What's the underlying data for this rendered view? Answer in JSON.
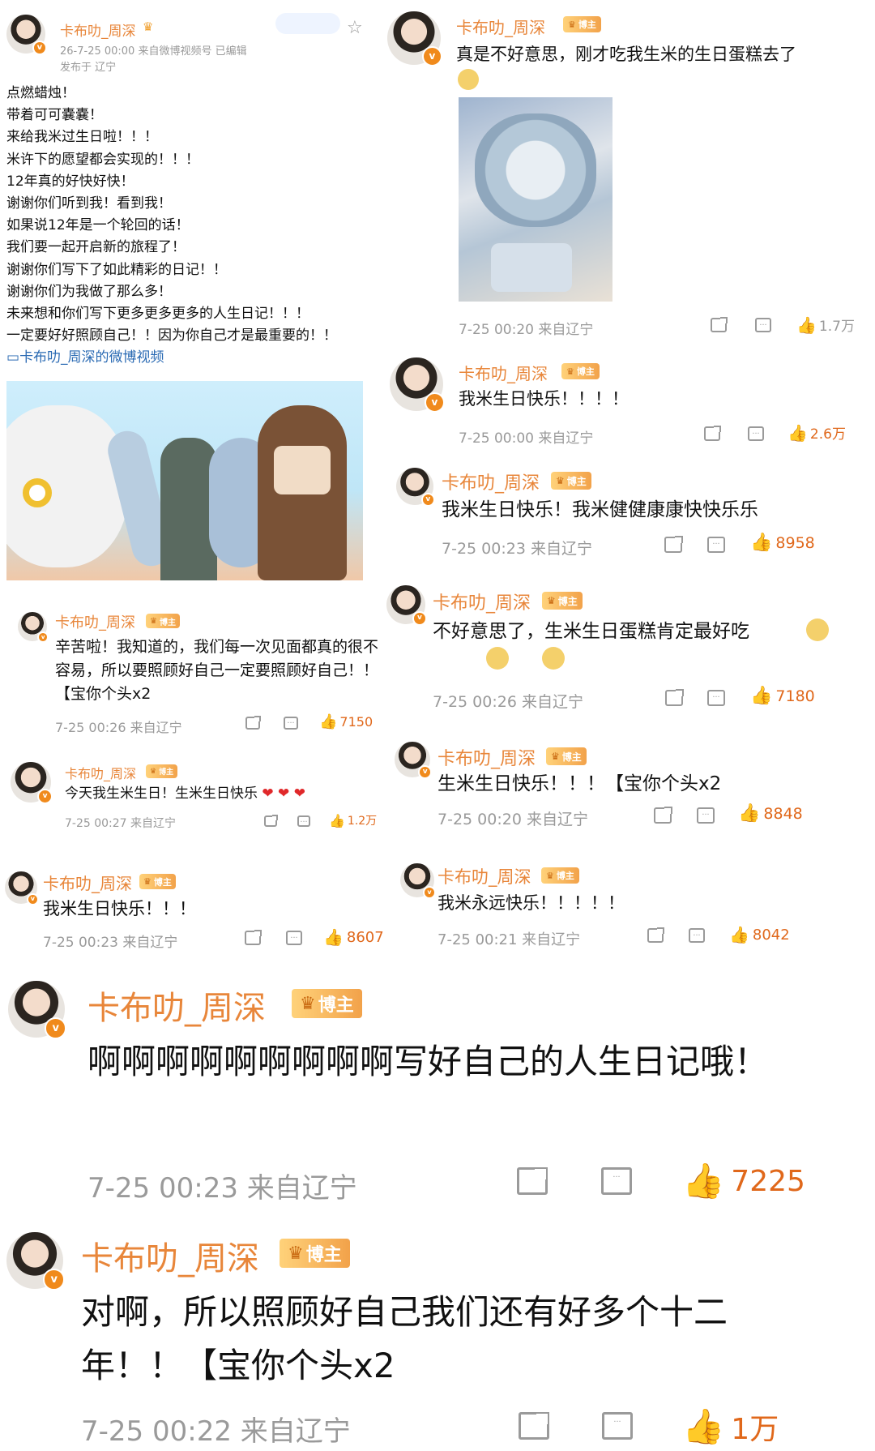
{
  "colors": {
    "username": "#e8863a",
    "like": "#e0681b",
    "meta": "#9a9a9a",
    "link": "#2a6ab3"
  },
  "badge_label": "博主",
  "main_post": {
    "username": "卡布叻_周深",
    "time_source": "26-7-25 00:00  来自微博视频号  已编辑",
    "location": "发布于 辽宁",
    "lines": [
      "点燃蜡烛！",
      "带着可可嚢嚢！",
      "来给我米过生日啦！！！",
      "米许下的愿望都会实现的！！！",
      "12年真的好快好快！",
      "谢谢你们听到我！看到我！",
      "如果说12年是一个轮回的话！",
      "我们要一起开启新的旅程了！",
      "谢谢你们写下了如此精彩的日记！！",
      "谢谢你们为我做了那么多！",
      "未来想和你们写下更多更多更多的人生日记！！！",
      "一定要好好照顾自己！！因为你自己才是最重要的！！"
    ],
    "video_link": "卡布叻_周深的微博视频"
  },
  "comments": [
    {
      "username": "卡布叻_周深",
      "text": "辛苦啦！我知道的，我们每一次见面都真的很不容易，所以要照顾好自己一定要照顾好自己！！【宝你个头x2",
      "time": "7-25 00:26 来自辽宁",
      "likes": "7150"
    },
    {
      "username": "卡布叻_周深",
      "text": "今天我生米生日！生米生日快乐",
      "time": "7-25 00:27 来自辽宁",
      "likes": "1.2万"
    },
    {
      "username": "卡布叻_周深",
      "text": "我米生日快乐！！！",
      "time": "7-25 00:23 来自辽宁",
      "likes": "8607"
    },
    {
      "username": "卡布叻_周深",
      "text": "真是不好意思，刚才吃我生米的生日蛋糕去了",
      "time": "7-25 00:20 来自辽宁",
      "likes": "1.7万"
    },
    {
      "username": "卡布叻_周深",
      "text": "我米生日快乐！！！！",
      "time": "7-25 00:00 来自辽宁",
      "likes": "2.6万"
    },
    {
      "username": "卡布叻_周深",
      "text": "我米生日快乐！我米健健康康快快乐乐",
      "time": "7-25 00:23 来自辽宁",
      "likes": "8958"
    },
    {
      "username": "卡布叻_周深",
      "text": "不好意思了，生米生日蛋糕肯定最好吃",
      "time": "7-25 00:26 来自辽宁",
      "likes": "7180"
    },
    {
      "username": "卡布叻_周深",
      "text": "生米生日快乐！！！【宝你个头x2",
      "time": "7-25 00:20 来自辽宁",
      "likes": "8848"
    },
    {
      "username": "卡布叻_周深",
      "text": "我米永远快乐！！！！！",
      "time": "7-25 00:21 来自辽宁",
      "likes": "8042"
    },
    {
      "username": "卡布叻_周深",
      "text": "啊啊啊啊啊啊啊啊啊写好自己的人生日记哦！",
      "time": "7-25 00:23 来自辽宁",
      "likes": "7225"
    },
    {
      "username": "卡布叻_周深",
      "text": "对啊，所以照顾好自己我们还有好多个十二年！！【宝你个头x2",
      "time": "7-25 00:22 来自辽宁",
      "likes": "1万"
    }
  ]
}
